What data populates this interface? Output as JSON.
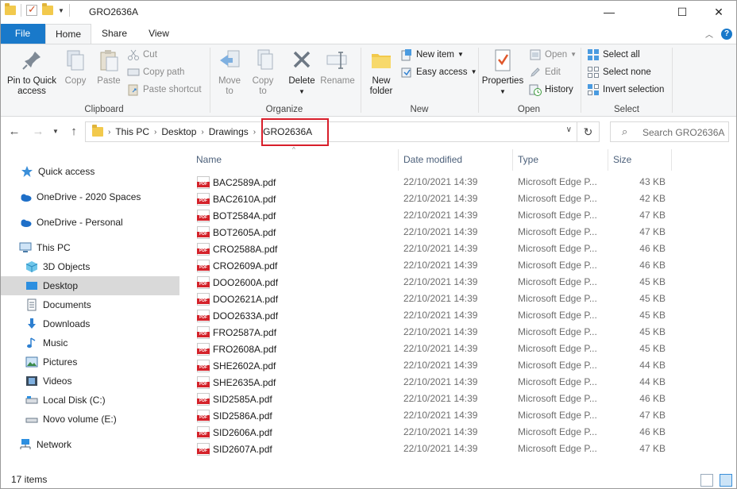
{
  "window": {
    "title": "GRO2636A"
  },
  "tabs": [
    {
      "label": "File"
    },
    {
      "label": "Home"
    },
    {
      "label": "Share"
    },
    {
      "label": "View"
    }
  ],
  "ribbon": {
    "clipboard": {
      "label": "Clipboard",
      "pin": "Pin to Quick\naccess",
      "copy": "Copy",
      "paste": "Paste",
      "cut": "Cut",
      "copy_path": "Copy path",
      "paste_shortcut": "Paste shortcut"
    },
    "organize": {
      "label": "Organize",
      "move_to": "Move\nto",
      "copy_to": "Copy\nto",
      "delete": "Delete",
      "rename": "Rename"
    },
    "new": {
      "label": "New",
      "new_folder": "New\nfolder",
      "new_item": "New item",
      "easy_access": "Easy access"
    },
    "open": {
      "label": "Open",
      "properties": "Properties",
      "open": "Open",
      "edit": "Edit",
      "history": "History"
    },
    "select": {
      "label": "Select",
      "select_all": "Select all",
      "select_none": "Select none",
      "invert": "Invert selection"
    }
  },
  "address": {
    "crumbs": [
      "This PC",
      "Desktop",
      "Drawings",
      "GRO2636A"
    ]
  },
  "search": {
    "placeholder": "Search GRO2636A"
  },
  "navpane": {
    "items": [
      {
        "label": "Quick access",
        "icon": "star-icon"
      },
      {
        "label": "OneDrive - 2020 Spaces",
        "icon": "cloud-icon"
      },
      {
        "label": "OneDrive - Personal",
        "icon": "cloud-icon"
      },
      {
        "label": "This PC",
        "icon": "computer-icon"
      },
      {
        "label": "3D Objects",
        "icon": "cube-icon"
      },
      {
        "label": "Desktop",
        "icon": "desktop-icon"
      },
      {
        "label": "Documents",
        "icon": "document-icon"
      },
      {
        "label": "Downloads",
        "icon": "download-icon"
      },
      {
        "label": "Music",
        "icon": "music-icon"
      },
      {
        "label": "Pictures",
        "icon": "picture-icon"
      },
      {
        "label": "Videos",
        "icon": "video-icon"
      },
      {
        "label": "Local Disk (C:)",
        "icon": "drive-icon"
      },
      {
        "label": "Novo volume (E:)",
        "icon": "drive-icon"
      },
      {
        "label": "Network",
        "icon": "network-icon"
      }
    ]
  },
  "columns": {
    "name": "Name",
    "date": "Date modified",
    "type": "Type",
    "size": "Size"
  },
  "files": [
    {
      "name": "BAC2589A.pdf",
      "date": "22/10/2021 14:39",
      "type": "Microsoft Edge P...",
      "size": "43 KB"
    },
    {
      "name": "BAC2610A.pdf",
      "date": "22/10/2021 14:39",
      "type": "Microsoft Edge P...",
      "size": "42 KB"
    },
    {
      "name": "BOT2584A.pdf",
      "date": "22/10/2021 14:39",
      "type": "Microsoft Edge P...",
      "size": "47 KB"
    },
    {
      "name": "BOT2605A.pdf",
      "date": "22/10/2021 14:39",
      "type": "Microsoft Edge P...",
      "size": "47 KB"
    },
    {
      "name": "CRO2588A.pdf",
      "date": "22/10/2021 14:39",
      "type": "Microsoft Edge P...",
      "size": "46 KB"
    },
    {
      "name": "CRO2609A.pdf",
      "date": "22/10/2021 14:39",
      "type": "Microsoft Edge P...",
      "size": "46 KB"
    },
    {
      "name": "DOO2600A.pdf",
      "date": "22/10/2021 14:39",
      "type": "Microsoft Edge P...",
      "size": "45 KB"
    },
    {
      "name": "DOO2621A.pdf",
      "date": "22/10/2021 14:39",
      "type": "Microsoft Edge P...",
      "size": "45 KB"
    },
    {
      "name": "DOO2633A.pdf",
      "date": "22/10/2021 14:39",
      "type": "Microsoft Edge P...",
      "size": "45 KB"
    },
    {
      "name": "FRO2587A.pdf",
      "date": "22/10/2021 14:39",
      "type": "Microsoft Edge P...",
      "size": "45 KB"
    },
    {
      "name": "FRO2608A.pdf",
      "date": "22/10/2021 14:39",
      "type": "Microsoft Edge P...",
      "size": "45 KB"
    },
    {
      "name": "SHE2602A.pdf",
      "date": "22/10/2021 14:39",
      "type": "Microsoft Edge P...",
      "size": "44 KB"
    },
    {
      "name": "SHE2635A.pdf",
      "date": "22/10/2021 14:39",
      "type": "Microsoft Edge P...",
      "size": "44 KB"
    },
    {
      "name": "SID2585A.pdf",
      "date": "22/10/2021 14:39",
      "type": "Microsoft Edge P...",
      "size": "46 KB"
    },
    {
      "name": "SID2586A.pdf",
      "date": "22/10/2021 14:39",
      "type": "Microsoft Edge P...",
      "size": "47 KB"
    },
    {
      "name": "SID2606A.pdf",
      "date": "22/10/2021 14:39",
      "type": "Microsoft Edge P...",
      "size": "46 KB"
    },
    {
      "name": "SID2607A.pdf",
      "date": "22/10/2021 14:39",
      "type": "Microsoft Edge P...",
      "size": "47 KB"
    }
  ],
  "status": {
    "count": "17 items"
  },
  "colors": {
    "accent": "#1979ca",
    "highlight": "#d81e2a",
    "selected": "#d9d9d9"
  }
}
